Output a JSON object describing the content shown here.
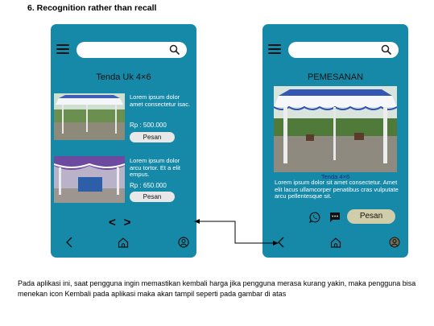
{
  "heading": "6. Recognition rather than recall",
  "phone_left": {
    "title": "Tenda Uk 4×6",
    "items": [
      {
        "text": "Lorem ipsum dolor amet consectetur isac.",
        "price": "Rp : 500.000",
        "button": "Pesan"
      },
      {
        "text": "Lorem ipsum dolor arcu tortor. Et a elit empus.",
        "price": "Rp : 650.000",
        "button": "Pesan"
      }
    ],
    "pagination": {
      "prev": "<",
      "next": ">"
    }
  },
  "phone_right": {
    "title": "PEMESANAN",
    "caption": "Tenda 4×6",
    "description": "Lorem ipsum dolor sit amet consectetur. Amet elit lacus ullamcorper penatibus cras vulputate arcu pellentesque sit.",
    "button": "Pesan"
  },
  "paragraph": "Pada aplikasi ini, saat pengguna ingin memastikan kembali harga jika pengguna merasa kurang yakin, maka pengguna bisa menekan icon Kembali pada aplikasi maka akan  tampil seperti pada gambar di atas",
  "colors": {
    "screen": "#1789a8",
    "search": "#ffffff",
    "pesan_button": "#d0cdaa"
  }
}
